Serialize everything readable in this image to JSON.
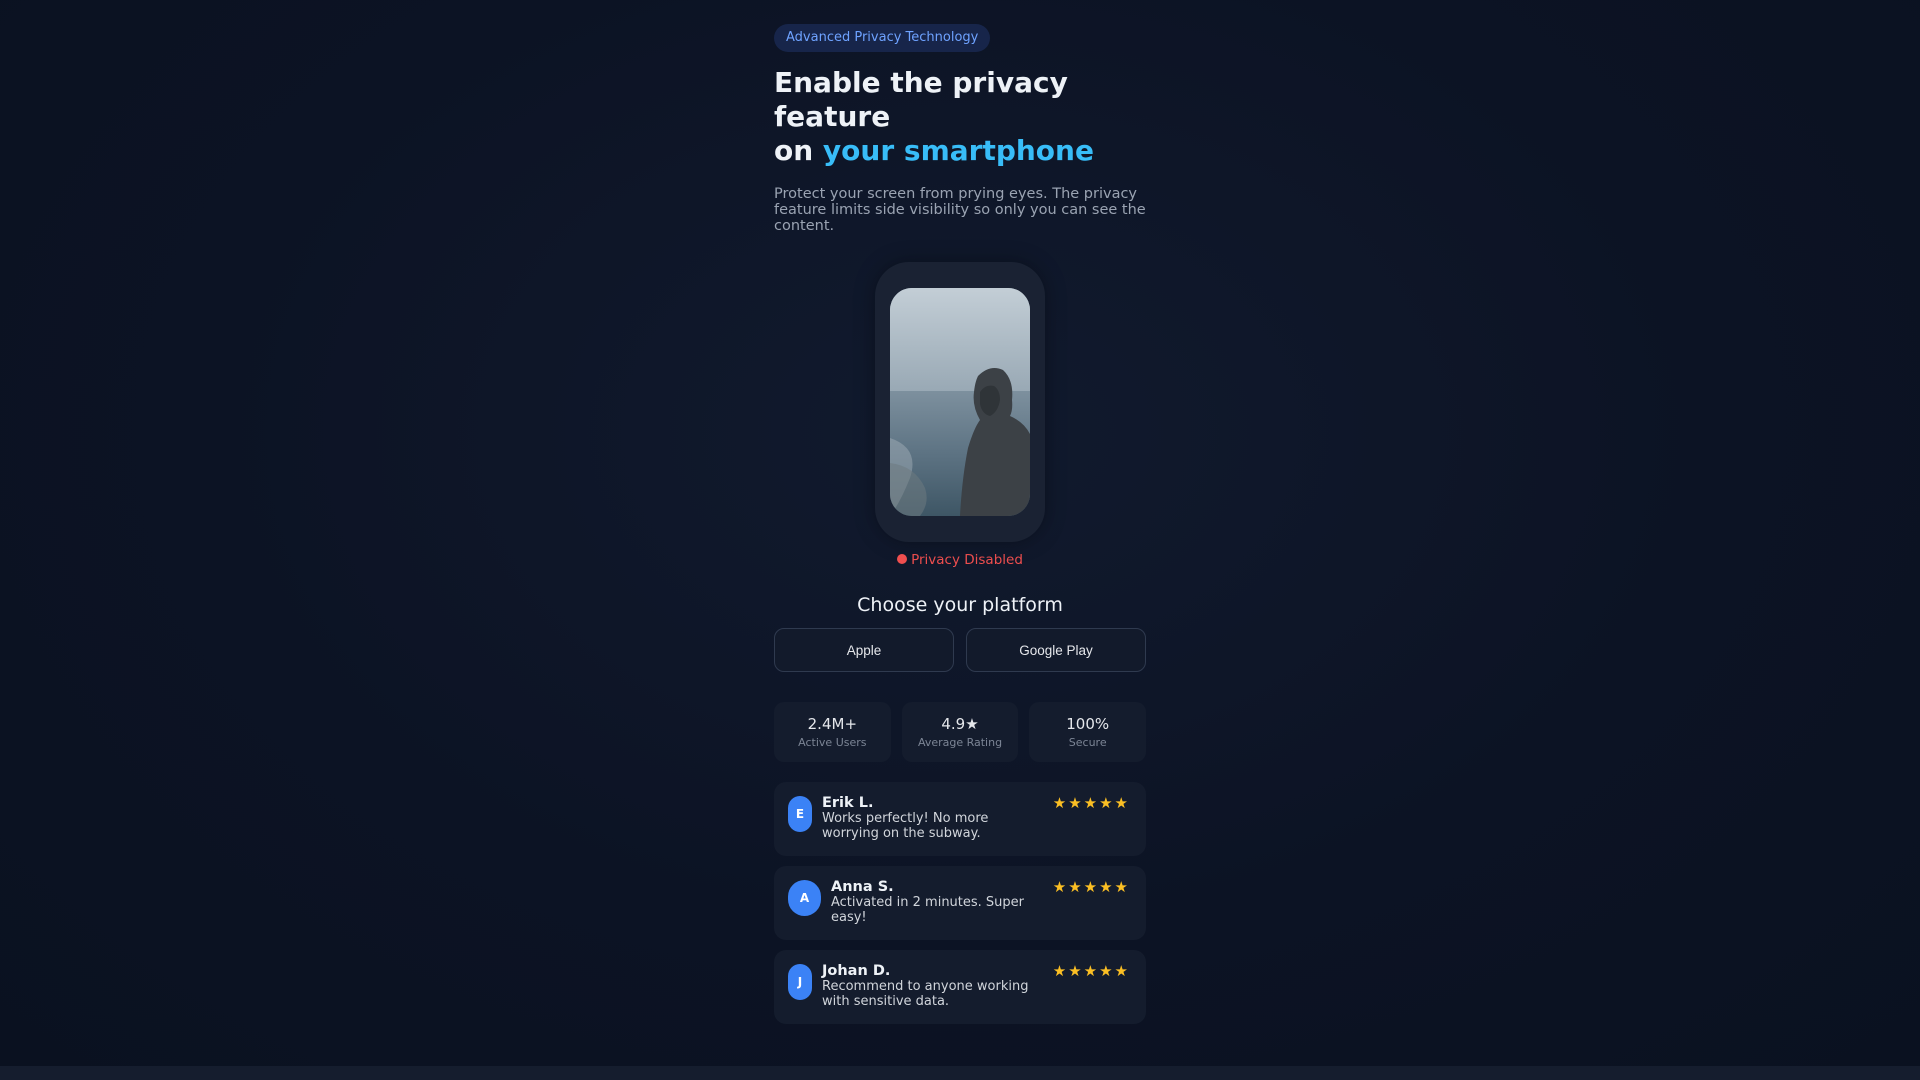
{
  "badge": "Advanced Privacy Technology",
  "headline": {
    "line1": "Enable the privacy feature",
    "line2_prefix": "on ",
    "line2_accent": "your smartphone"
  },
  "description": "Protect your screen from prying eyes. The privacy feature limits side visibility so only you can see the content.",
  "status": "Privacy Disabled",
  "choose_title": "Choose your platform",
  "platforms": [
    "Apple",
    "Google Play"
  ],
  "stats": [
    {
      "value": "2.4M+",
      "label": "Active Users"
    },
    {
      "value": "4.9★",
      "label": "Average Rating"
    },
    {
      "value": "100%",
      "label": "Secure"
    }
  ],
  "reviews": [
    {
      "initial": "E",
      "name": "Erik L.",
      "text": "Works perfectly! No more worrying on the subway.",
      "rating": 5,
      "stars": "★★★★★"
    },
    {
      "initial": "A",
      "name": "Anna S.",
      "text": "Activated in 2 minutes. Super easy!",
      "rating": 5,
      "stars": "★★★★★"
    },
    {
      "initial": "J",
      "name": "Johan D.",
      "text": "Recommend to anyone working with sensitive data.",
      "rating": 5,
      "stars": "★★★★★"
    }
  ],
  "colors": {
    "background": "#0c1324",
    "accent": "#38bdf8",
    "badge_text": "#6ea2ff",
    "status_disabled": "#f04f4f",
    "avatar": "#3b82f6",
    "star": "#fbbf24"
  }
}
